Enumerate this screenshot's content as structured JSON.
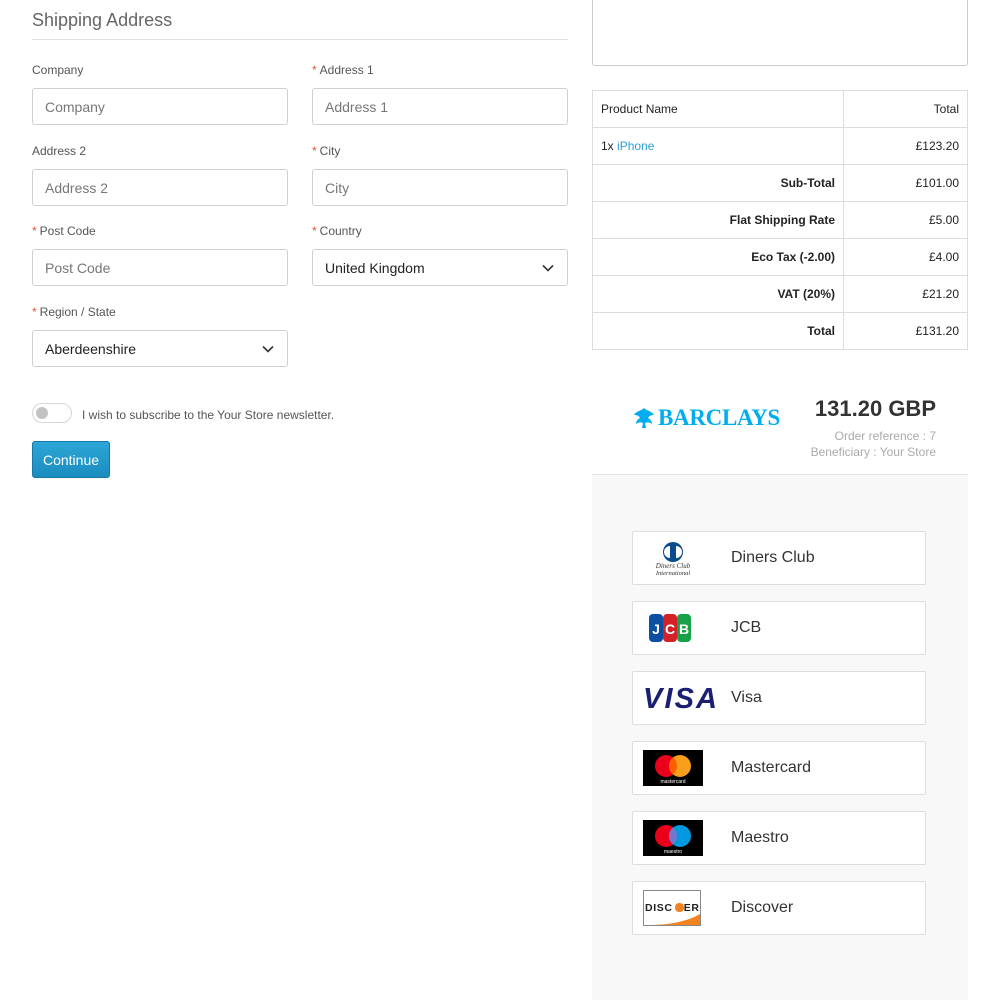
{
  "shipping": {
    "title": "Shipping Address",
    "company": {
      "label": "Company",
      "placeholder": "Company"
    },
    "address1": {
      "label": "Address 1",
      "placeholder": "Address 1",
      "required": "*"
    },
    "address2": {
      "label": "Address 2",
      "placeholder": "Address 2"
    },
    "city": {
      "label": "City",
      "placeholder": "City",
      "required": "*"
    },
    "postcode": {
      "label": "Post Code",
      "placeholder": "Post Code",
      "required": "*"
    },
    "country": {
      "label": "Country",
      "value": "United Kingdom",
      "required": "*"
    },
    "region": {
      "label": "Region / State",
      "value": "Aberdeenshire",
      "required": "*"
    },
    "newsletter": "I wish to subscribe to the Your Store newsletter.",
    "continue_label": "Continue"
  },
  "order_table": {
    "headers": [
      "Product Name",
      "Total"
    ],
    "product": {
      "qty": "1x",
      "name": "iPhone",
      "total": "£123.20"
    },
    "rows": [
      {
        "label": "Sub-Total",
        "value": "£101.00"
      },
      {
        "label": "Flat Shipping Rate",
        "value": "£5.00"
      },
      {
        "label": "Eco Tax (-2.00)",
        "value": "£4.00"
      },
      {
        "label": "VAT (20%)",
        "value": "£21.20"
      },
      {
        "label": "Total",
        "value": "£131.20"
      }
    ]
  },
  "payment": {
    "brand": "BARCLAYS",
    "amount": "131.20 GBP",
    "order_reference": "Order reference : 7",
    "beneficiary": "Beneficiary : Your Store",
    "cards": [
      {
        "label": "Diners Club",
        "icon": "diners-club-icon",
        "logo_text": "Diners Club International"
      },
      {
        "label": "JCB",
        "icon": "jcb-icon",
        "logo_text": "JCB"
      },
      {
        "label": "Visa",
        "icon": "visa-icon",
        "logo_text": "VISA"
      },
      {
        "label": "Mastercard",
        "icon": "mastercard-icon",
        "logo_text": "mastercard"
      },
      {
        "label": "Maestro",
        "icon": "maestro-icon",
        "logo_text": "maestro"
      },
      {
        "label": "Discover",
        "icon": "discover-icon",
        "logo_text": "DISCOVER"
      }
    ]
  },
  "colors": {
    "accent": "#2a9fd6",
    "required": "#e3503e",
    "button": "#1b8dbf",
    "barclays": "#00aeef"
  }
}
